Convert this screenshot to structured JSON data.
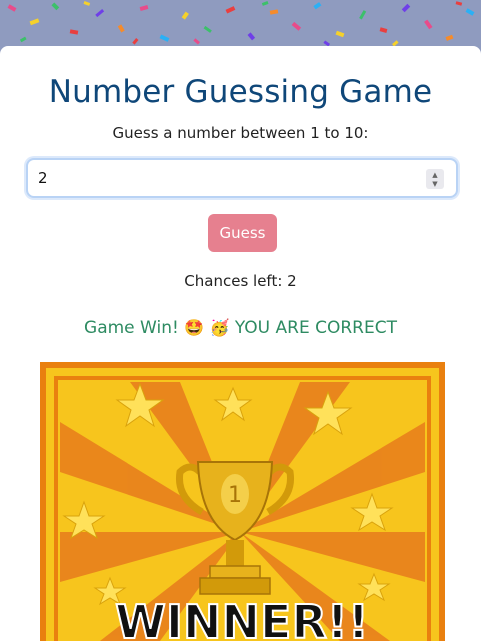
{
  "header": {
    "title": "Number Guessing Game",
    "prompt": "Guess a number between 1 to 10:"
  },
  "input": {
    "value": "2"
  },
  "guess_button": {
    "label": "Guess"
  },
  "status": {
    "chances_text": "Chances left: 2",
    "result_prefix": "Game Win!",
    "result_emoji_1": "🤩",
    "result_emoji_2": "🥳",
    "result_suffix": "YOU ARE CORRECT"
  },
  "winner_image": {
    "trophy_number": "1",
    "banner_text": "WINNER!!"
  },
  "colors": {
    "title": "#0f4779",
    "button": "#e6808f",
    "result": "#2e8b62",
    "background": "#8f9bbf"
  }
}
